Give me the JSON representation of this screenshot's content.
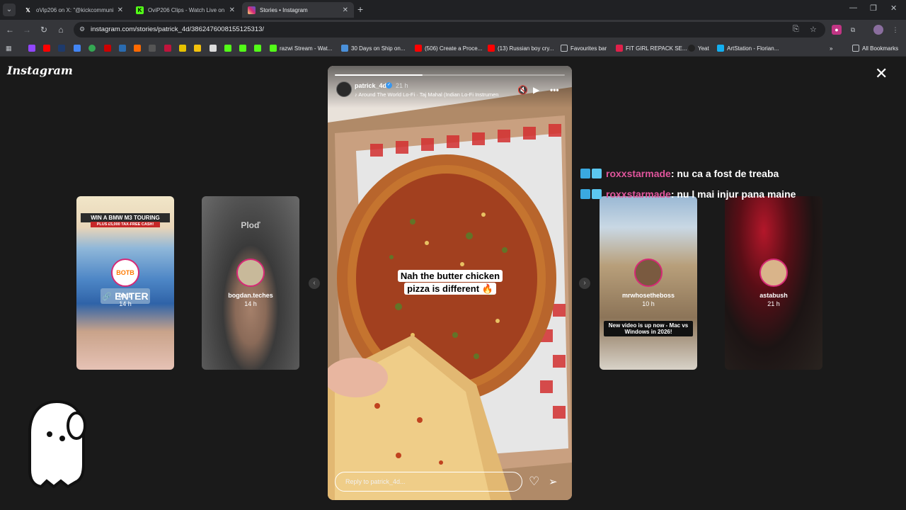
{
  "browser": {
    "tabs": [
      {
        "title": "oVip206 on X: \"@kickcommuni",
        "favicon": "x-icon",
        "active": false
      },
      {
        "title": "OviP206 Clips - Watch Live on",
        "favicon": "kick-icon",
        "active": false
      },
      {
        "title": "Stories • Instagram",
        "favicon": "instagram-icon",
        "active": true
      }
    ],
    "url": "instagram.com/stories/patrick_4d/3862476008155125313/",
    "bookmarks": [
      {
        "label": "razwi Stream - Wat..."
      },
      {
        "label": "30 Days on Ship on..."
      },
      {
        "label": "(506) Create a Proce..."
      },
      {
        "label": "(13) Russian boy cry..."
      },
      {
        "label": "Favourites bar"
      },
      {
        "label": "FIT GIRL REPACK SE..."
      },
      {
        "label": "Yeat"
      },
      {
        "label": "ArtStation - Florian..."
      }
    ],
    "all_bookmarks": "All Bookmarks"
  },
  "page": {
    "logo": "Instagram",
    "left_stories": [
      {
        "name": "botb",
        "time": "14 h",
        "banner": "WIN A BMW M3 TOURING",
        "subbanner": "PLUS £5,000 TAX-FREE CASH!",
        "cta": "ENTER",
        "brand": "BOTB"
      },
      {
        "name": "bogdan.teches",
        "time": "14 h",
        "overlay": "Ploď"
      }
    ],
    "right_stories": [
      {
        "name": "mrwhosetheboss",
        "time": "10 h",
        "overlay": "New video is up now - Mac vs Windows in 2026!"
      },
      {
        "name": "astabush",
        "time": "21 h"
      }
    ],
    "current_story": {
      "username": "patrick_4d",
      "time": "21 h",
      "music": "Around The World Lo-Fi · Taj Mahal (Indian Lo-Fi Instrumen",
      "caption_line1": "Nah the butter chicken",
      "caption_line2": "pizza is different 🔥",
      "reply_placeholder": "Reply to patrick_4d...",
      "progress": 0.38
    },
    "chat": [
      {
        "user": "roxxstarmade",
        "message": ": nu ca a fost de treaba"
      },
      {
        "user": "roxxstarmade",
        "message": ": nu l mai injur pana maine"
      }
    ]
  }
}
